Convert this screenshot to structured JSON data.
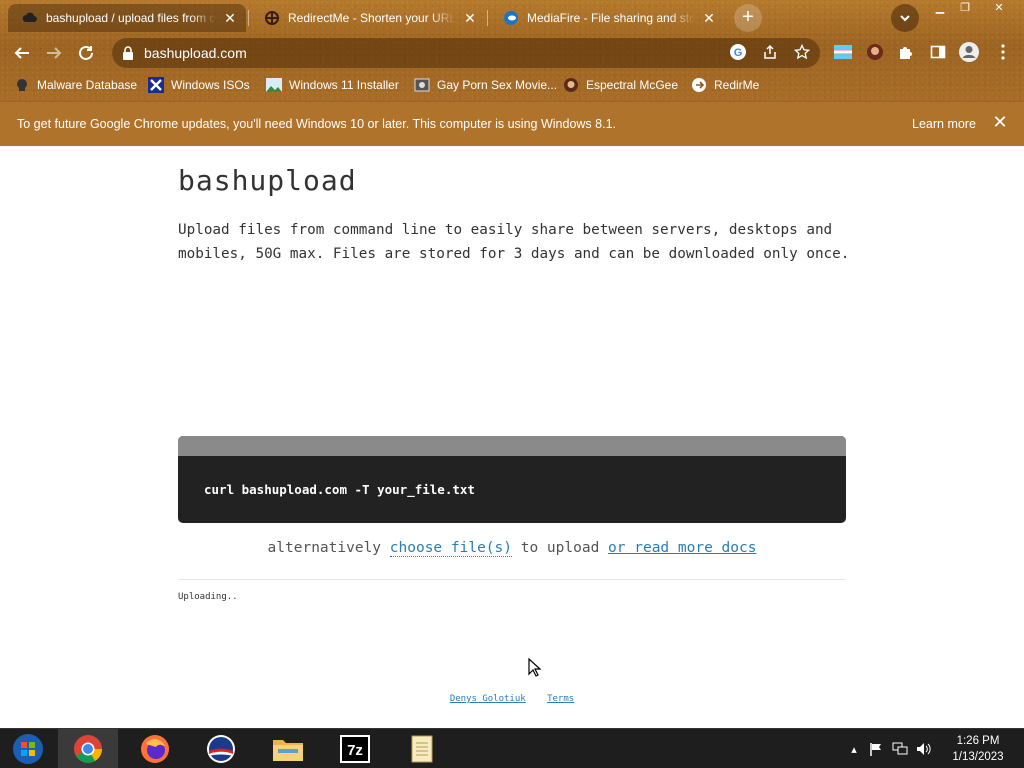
{
  "browser": {
    "tabs": [
      {
        "title": "bashupload / upload files from com",
        "favicon": "cloud-upload-icon",
        "active": true
      },
      {
        "title": "RedirectMe - Shorten your URL",
        "favicon": "crosshair-icon",
        "active": false
      },
      {
        "title": "MediaFire - File sharing and storage",
        "favicon": "mediafire-icon",
        "active": false
      }
    ],
    "new_tab_label": "+",
    "url": "bashupload.com",
    "bookmarks": [
      {
        "label": "Malware Database",
        "icon": "skull-icon"
      },
      {
        "label": "Windows ISOs",
        "icon": "x-logo-icon"
      },
      {
        "label": "Windows 11 Installer",
        "icon": "image-icon"
      },
      {
        "label": "Gay Porn Sex Movie...",
        "icon": "globe-icon"
      },
      {
        "label": "Espectral McGee",
        "icon": "avatar-icon"
      },
      {
        "label": "RedirMe",
        "icon": "redirect-icon"
      }
    ],
    "infobar": {
      "message": "To get future Google Chrome updates, you'll need Windows 10 or later. This computer is using Windows 8.1.",
      "action": "Learn more"
    }
  },
  "page": {
    "title": "bashupload",
    "description": "Upload files from command line to easily share between servers, desktops and mobiles, 50G max. Files are stored for 3 days and can be downloaded only once.",
    "command": "curl bashupload.com -T your_file.txt",
    "alt_prefix": "alternatively",
    "choose_link": "choose file(s)",
    "alt_middle": "to upload",
    "docs_link": "or read more docs",
    "status": "Uploading..",
    "footer": {
      "author": "Denys Golotiuk",
      "terms": "Terms"
    }
  },
  "taskbar": {
    "apps": [
      "start-orb",
      "chrome",
      "firefox",
      "obama-logo",
      "file-explorer",
      "7zip",
      "notepad"
    ],
    "time": "1:26 PM",
    "date": "1/13/2023"
  },
  "colors": {
    "chrome_bg": "#a86d27",
    "infobar_bg": "#b0732c",
    "link": "#2a7db3",
    "code_bg": "#222222"
  }
}
